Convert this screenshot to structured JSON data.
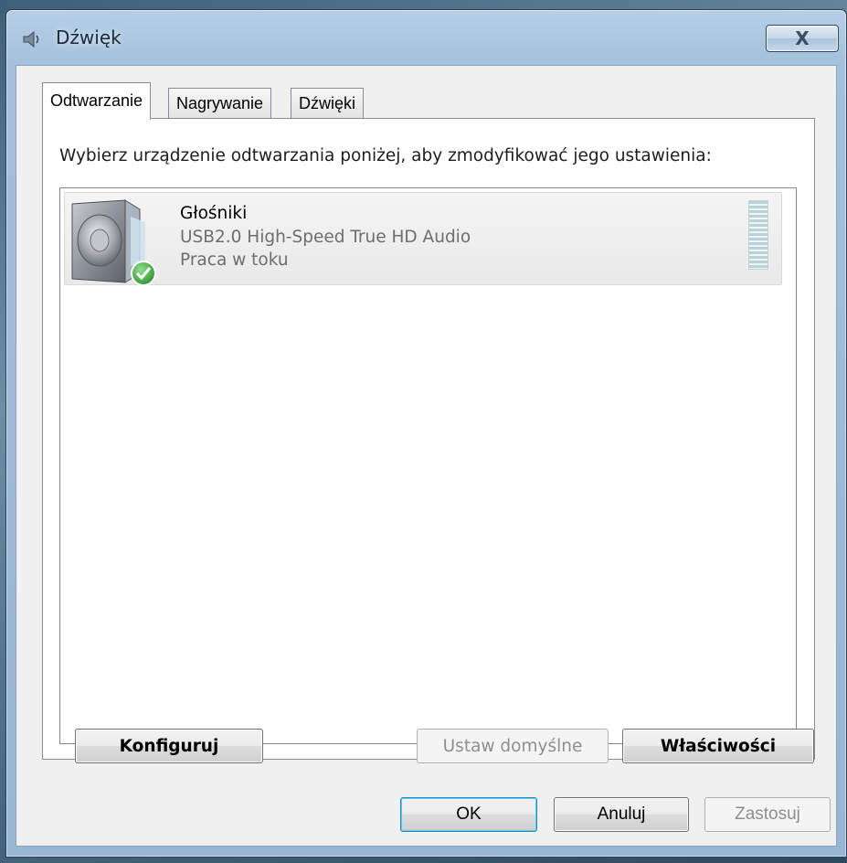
{
  "window": {
    "title": "Dźwięk",
    "close_label": "X"
  },
  "tabs": [
    {
      "label": "Odtwarzanie",
      "active": true
    },
    {
      "label": "Nagrywanie",
      "active": false
    },
    {
      "label": "Dźwięki",
      "active": false
    }
  ],
  "panel": {
    "instruction": "Wybierz urządzenie odtwarzania poniżej, aby zmodyfikować jego ustawienia:",
    "devices": [
      {
        "name": "Głośniki",
        "description": "USB2.0 High-Speed True HD Audio",
        "status": "Praca w toku",
        "icon": "speaker-icon",
        "default_badge": "check-icon"
      }
    ],
    "configure_button": "Konfiguruj",
    "set_default_button": "Ustaw domyślne",
    "properties_button": "Właściwości"
  },
  "footer": {
    "ok_button": "OK",
    "cancel_button": "Anuluj",
    "apply_button": "Zastosuj"
  },
  "colors": {
    "titlebar": "#a3c0dc",
    "dialog_bg": "#f0f0f0",
    "check_green": "#3aa63a"
  }
}
